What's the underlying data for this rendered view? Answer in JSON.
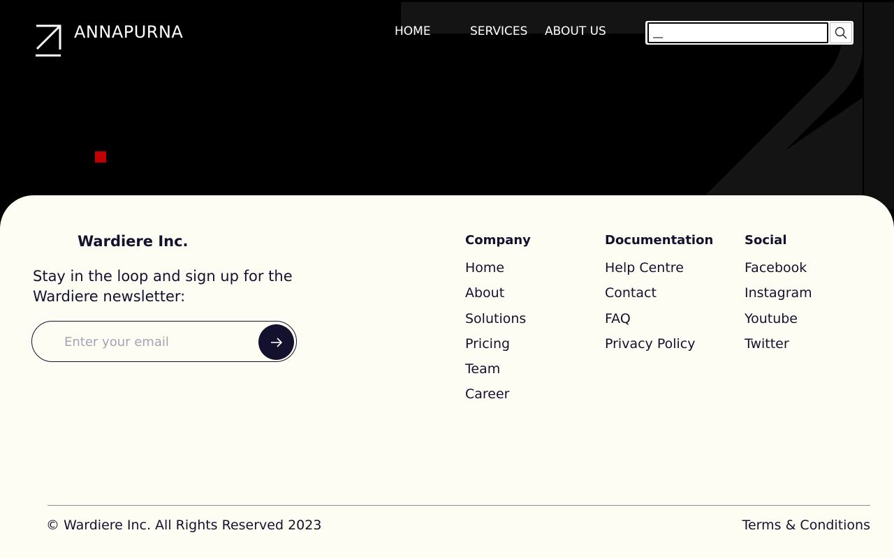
{
  "header": {
    "brand": "ANNAPURNA",
    "nav": [
      {
        "label": "HOME"
      },
      {
        "label": "SERVICES"
      },
      {
        "label": "ABOUT US"
      }
    ],
    "search": {
      "value": "__",
      "placeholder": ""
    }
  },
  "footer": {
    "brand_name": "Wardiere Inc.",
    "newsletter_text": "Stay in the loop and sign up for the Wardiere newsletter:",
    "email_placeholder": "Enter your email",
    "columns": [
      {
        "title": "Company",
        "items": [
          "Home",
          "About",
          "Solutions",
          "Pricing",
          "Team",
          "Career"
        ]
      },
      {
        "title": "Documentation",
        "items": [
          "Help Centre",
          "Contact",
          "FAQ",
          "Privacy Policy"
        ]
      },
      {
        "title": "Social",
        "items": [
          "Facebook",
          "Instagram",
          "Youtube",
          "Twitter"
        ]
      }
    ],
    "copyright": "© Wardiere Inc. All Rights Reserved 2023",
    "terms": "Terms & Conditions"
  },
  "icons": {
    "logo": "arrow-up-right-logo-icon",
    "search": "search-icon",
    "submit": "arrow-right-icon",
    "hero_marker": "red-square"
  },
  "colors": {
    "hero_bg": "#000000",
    "footer_bg": "#fdfdf3",
    "text_dark": "#14112e",
    "accent_red": "#c00000"
  }
}
